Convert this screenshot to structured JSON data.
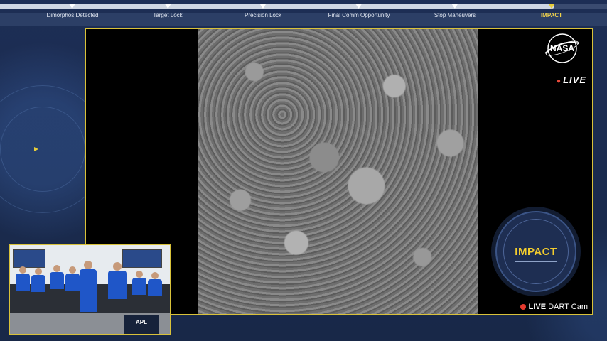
{
  "timeline": {
    "milestones": [
      {
        "label": "Dimorphos Detected",
        "active": false
      },
      {
        "label": "Target Lock",
        "active": false
      },
      {
        "label": "Precision Lock",
        "active": false
      },
      {
        "label": "Final Comm Opportunity",
        "active": false
      },
      {
        "label": "Stop Maneuvers",
        "active": false
      },
      {
        "label": "IMPACT",
        "active": true
      }
    ]
  },
  "broadcast": {
    "logo_text": "NASA",
    "live_label": "LIVE",
    "impact_label": "IMPACT",
    "cam_live": "LIVE",
    "cam_name": "DART Cam"
  },
  "pip": {
    "podium_text": "APL"
  },
  "colors": {
    "accent_yellow": "#f2cc2e",
    "live_red": "#e53a2e",
    "background_navy": "#1a2a4e"
  }
}
